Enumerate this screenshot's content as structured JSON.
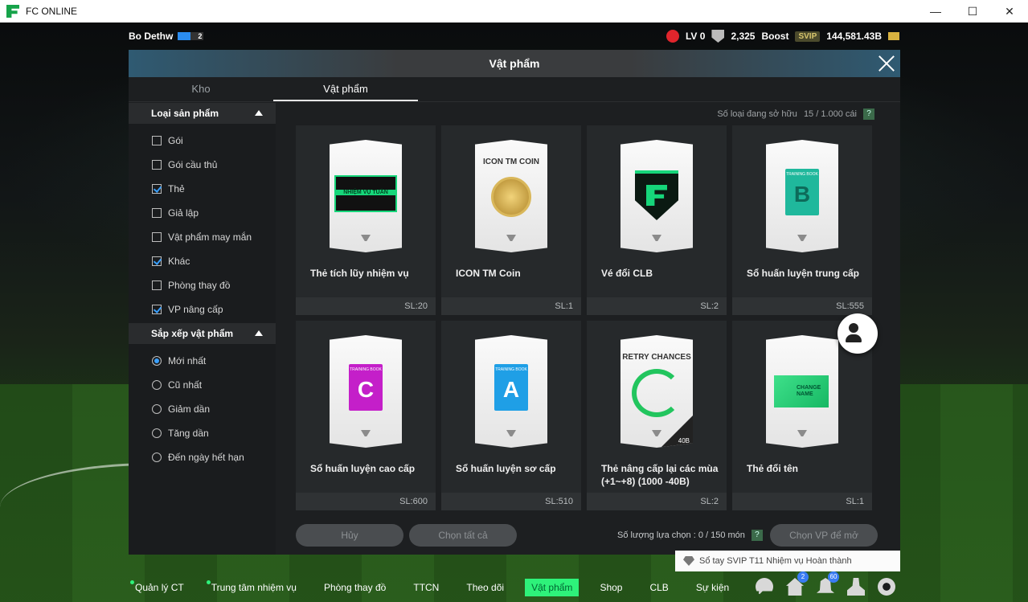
{
  "window": {
    "title": "FC ONLINE",
    "buttons": [
      "—",
      "☐",
      "✕"
    ]
  },
  "hud": {
    "player_name": "Bo  Dethw",
    "player_badge": "2",
    "level": "LV 0",
    "trophy_value": "2,325",
    "boost_label": "Boost",
    "svip_label": "SVIP",
    "currency": "144,581.43B"
  },
  "modal": {
    "title": "Vật phẩm",
    "tabs": [
      {
        "label": "Kho"
      },
      {
        "label": "Vật phẩm"
      }
    ],
    "active_tab": 1
  },
  "filters": {
    "product_type": {
      "title": "Loại sản phẩm",
      "options": [
        {
          "label": "Gói",
          "checked": false
        },
        {
          "label": "Gói cầu thủ",
          "checked": false
        },
        {
          "label": "Thẻ",
          "checked": true
        },
        {
          "label": "Giả lập",
          "checked": false
        },
        {
          "label": "Vật phẩm may mắn",
          "checked": false
        },
        {
          "label": "Khác",
          "checked": true
        },
        {
          "label": "Phòng thay đồ",
          "checked": false
        },
        {
          "label": "VP nâng cấp",
          "checked": true
        }
      ]
    },
    "sort": {
      "title": "Sắp xếp vật phẩm",
      "options": [
        {
          "label": "Mới nhất",
          "selected": true
        },
        {
          "label": "Cũ nhất",
          "selected": false
        },
        {
          "label": "Giảm dần",
          "selected": false
        },
        {
          "label": "Tăng dần",
          "selected": false
        },
        {
          "label": "Đến ngày hết hạn",
          "selected": false
        }
      ]
    }
  },
  "owned": {
    "label": "Số loại đang sở hữu",
    "value": "15 / 1.000 cái",
    "help": "?"
  },
  "items": [
    {
      "name": "Thẻ tích lũy nhiệm vụ",
      "qty": "SL:20",
      "art": "ticket",
      "art_text": "NHIỆM VỤ TUẦN"
    },
    {
      "name": "ICON TM Coin",
      "qty": "SL:1",
      "art": "coin",
      "art_text": "ICON TM COIN"
    },
    {
      "name": "Vé đổi CLB",
      "qty": "SL:2",
      "art": "shield",
      "art_text": ""
    },
    {
      "name": "Sổ huấn luyện trung cấp",
      "qty": "SL:555",
      "art": "book",
      "art_text": "B",
      "color": "#1fb89c",
      "book_label": "TRAINING BOOK"
    },
    {
      "name": "Sổ huấn luyện cao cấp",
      "qty": "SL:600",
      "art": "book",
      "art_text": "C",
      "color": "#c41fc9",
      "book_label": "TRAINING BOOK"
    },
    {
      "name": "Sổ huấn luyện sơ cấp",
      "qty": "SL:510",
      "art": "book",
      "art_text": "A",
      "color": "#1f9fe6",
      "book_label": "TRAINING BOOK"
    },
    {
      "name": "Thẻ nâng cấp lại các mùa (+1~+8) (1000 -40B)",
      "qty": "SL:2",
      "art": "retry",
      "art_text": "RETRY CHANCES",
      "corner_text": "40B"
    },
    {
      "name": "Thẻ đổi tên",
      "qty": "SL:1",
      "art": "rename",
      "art_text": "CHANGE NAME"
    }
  ],
  "actions": {
    "cancel_label": "Hủy",
    "select_all_label": "Chọn tất cả",
    "select_count_label": "Số lượng lựa chọn : 0 / 150 món",
    "open_label": "Chọn VP để mở"
  },
  "notice": {
    "text": "Sổ tay SVIP T11 Nhiệm vụ Hoàn thành"
  },
  "nav": {
    "items": [
      {
        "label": "Quản lý CT",
        "dot": true
      },
      {
        "label": "Trung tâm nhiệm vụ",
        "dot": true
      },
      {
        "label": "Phòng thay đồ",
        "dot": false
      },
      {
        "label": "TTCN",
        "dot": false
      },
      {
        "label": "Theo dõi",
        "dot": false
      },
      {
        "label": "Vật phẩm",
        "dot": false,
        "active": true
      },
      {
        "label": "Shop",
        "dot": false
      },
      {
        "label": "CLB",
        "dot": false
      },
      {
        "label": "Sự kiện",
        "dot": false
      }
    ],
    "badges": {
      "home": "2",
      "bell": "60"
    }
  },
  "colors": {
    "accent": "#2ef27a",
    "checkbox": "#3aa0ff",
    "modal_bg": "#1d1f21"
  }
}
